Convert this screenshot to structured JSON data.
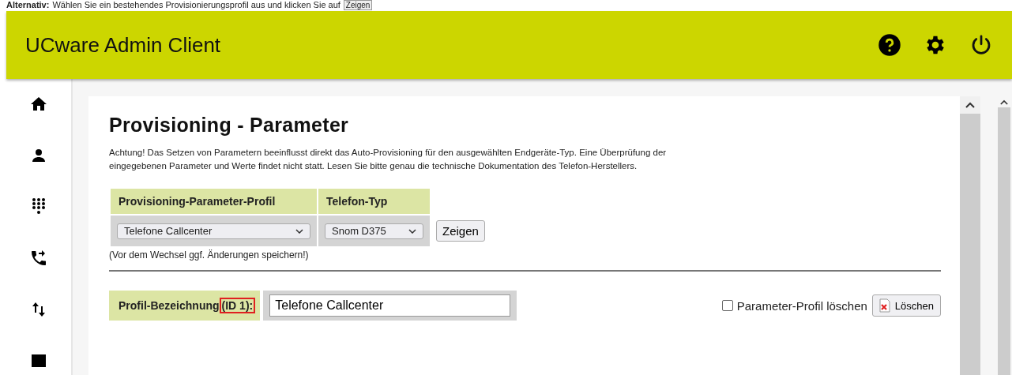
{
  "hint": {
    "lead": "Alternativ:",
    "text": "Wählen Sie ein bestehendes Provisionierungsprofil aus und klicken Sie auf",
    "button": "Zeigen"
  },
  "header": {
    "title": "UCware Admin Client"
  },
  "page": {
    "heading": "Provisioning - Parameter",
    "warning": "Achtung! Das Setzen von Parametern beeinflusst direkt das Auto-Provisioning für den ausgewählten Endgeräte-Typ. Eine Überprüfung der eingegebenen Parameter und Werte findet nicht statt. Lesen Sie bitte genau die technische Dokumentation des Telefon-Herstellers.",
    "table": {
      "columns": [
        "Provisioning-Parameter-Profil",
        "Telefon-Typ"
      ],
      "values": [
        "Telefone Callcenter",
        "Snom D375"
      ],
      "button": "Zeigen"
    },
    "note": "(Vor dem Wechsel ggf. Änderungen speichern!)",
    "profile": {
      "label": "Profil-Bezeichnung",
      "id": "(ID 1):",
      "value": "Telefone Callcenter",
      "delete_checkbox": {
        "label": "Parameter-Profil löschen",
        "checked": false
      },
      "delete_button": "Löschen"
    }
  }
}
